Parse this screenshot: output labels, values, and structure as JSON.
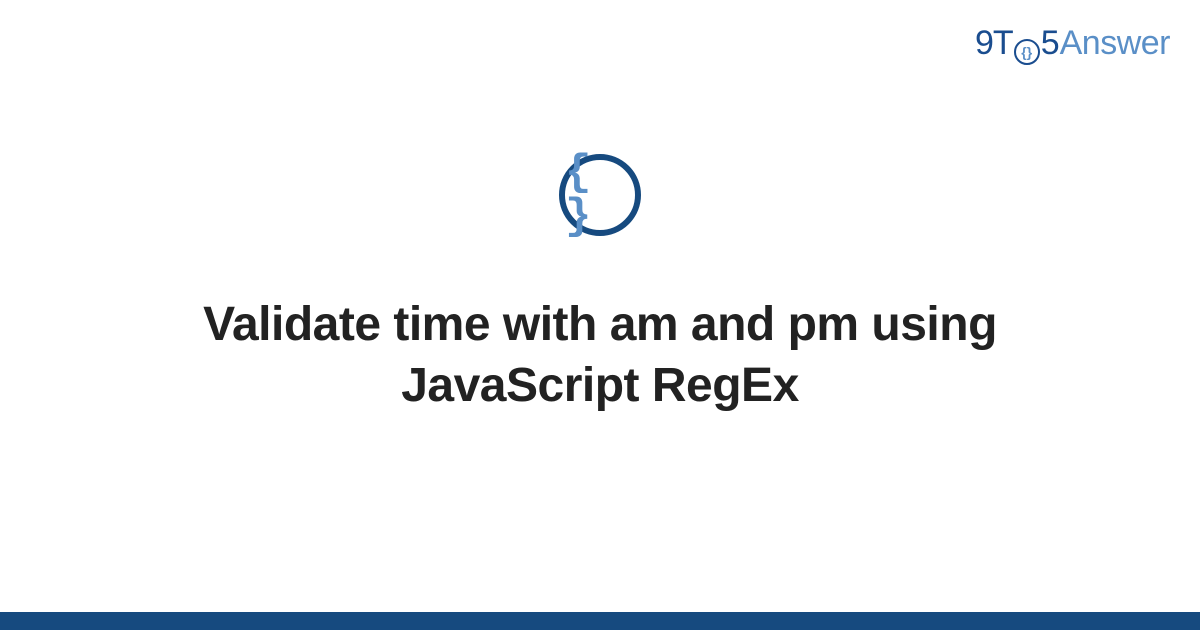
{
  "logo": {
    "part1": "9T",
    "circle_text": "{}",
    "part2": "5",
    "part3": "Answer"
  },
  "icon": {
    "name": "braces-icon",
    "glyph": "{ }"
  },
  "title": "Validate time with am and pm using JavaScript RegEx",
  "colors": {
    "primary_dark": "#164a7f",
    "primary_light": "#5a8fc7",
    "text": "#222222",
    "background": "#ffffff"
  }
}
